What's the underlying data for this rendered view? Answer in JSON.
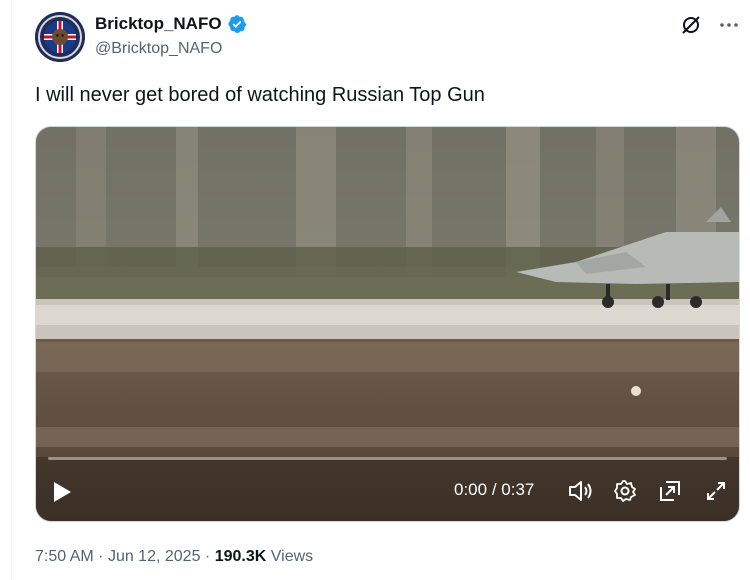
{
  "author": {
    "display_name": "Bricktop_NAFO",
    "handle": "@Bricktop_NAFO",
    "verified": true,
    "avatar_icon": "nafo-badge-avatar"
  },
  "tweet": {
    "text": "I will never get bored of watching Russian Top Gun"
  },
  "video": {
    "current_time": "0:00",
    "separator": "/",
    "duration": "0:37",
    "progress": 0.0,
    "controls": [
      "play-icon",
      "volume-icon",
      "settings-gear-icon",
      "picture-in-picture-icon",
      "fullscreen-icon"
    ]
  },
  "meta": {
    "time": "7:50 AM",
    "dot": "·",
    "date": "Jun 12, 2025",
    "views_count": "190.3K",
    "views_label": "Views"
  },
  "colors": {
    "accent": "#1d9bf0",
    "text": "#0f1419",
    "muted": "#536471"
  }
}
